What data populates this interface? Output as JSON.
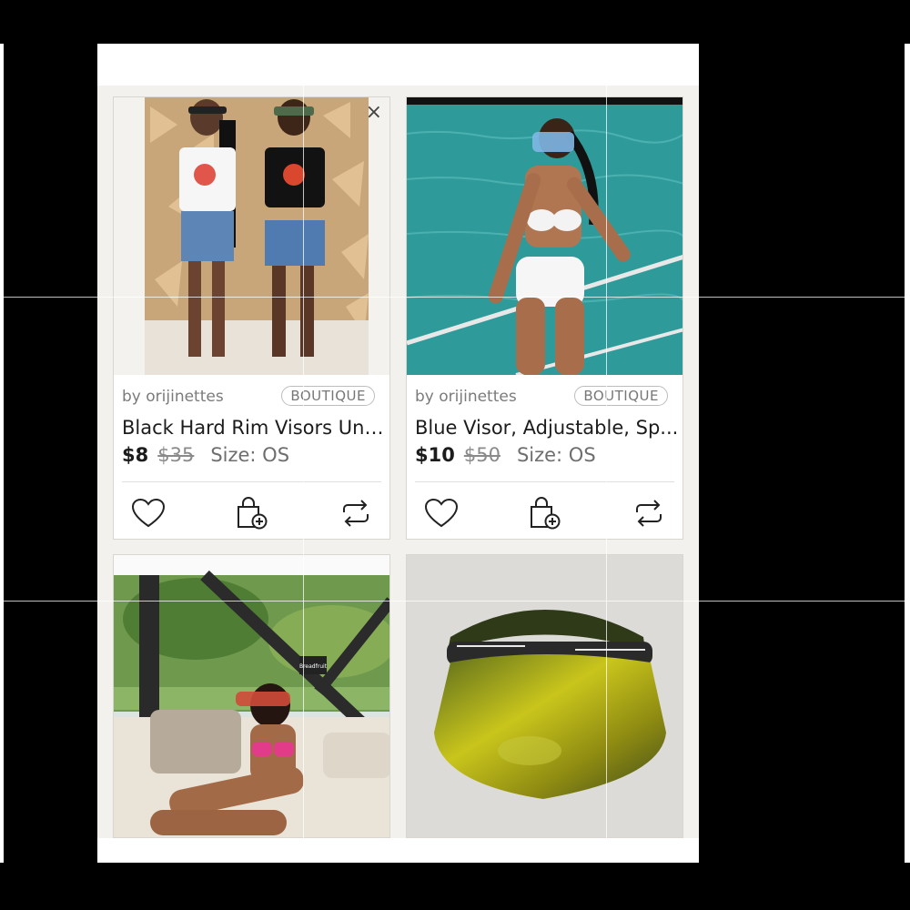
{
  "listings": [
    {
      "seller": "by orijinettes",
      "badge": "BOUTIQUE",
      "title": "Black Hard Rim Visors Uni...",
      "price": "$8",
      "original_price": "$35",
      "size": "Size: OS",
      "close_glyph": "×"
    },
    {
      "seller": "by orijinettes",
      "badge": "BOUTIQUE",
      "title": "Blue Visor, Adjustable, Sp...",
      "price": "$10",
      "original_price": "$50",
      "size": "Size: OS"
    },
    {
      "sign_text": "Breadfruit"
    },
    {}
  ],
  "icons": {
    "like": "heart-icon",
    "bag": "add-to-bag-icon",
    "share": "share-icon"
  },
  "colors": {
    "panel_bg": "#f3f1ed",
    "text": "#1c1c1c",
    "muted": "#7b7b7b"
  }
}
